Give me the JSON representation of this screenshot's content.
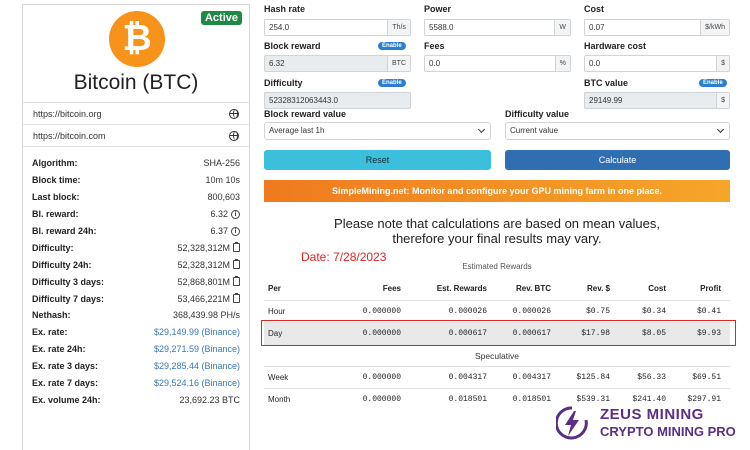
{
  "coin": {
    "name": "Bitcoin (BTC)",
    "symbol_glyph": "₿",
    "status": "Active",
    "links": [
      "https://bitcoin.org",
      "https://bitcoin.com"
    ]
  },
  "stats": [
    {
      "label": "Algorithm:",
      "value": "SHA-256",
      "icon": ""
    },
    {
      "label": "Block time:",
      "value": "10m 10s",
      "icon": ""
    },
    {
      "label": "Last block:",
      "value": "800,603",
      "icon": ""
    },
    {
      "label": "Bl. reward:",
      "value": "6.32",
      "icon": "info-icon"
    },
    {
      "label": "Bl. reward 24h:",
      "value": "6.37",
      "icon": "info-icon"
    },
    {
      "label": "Difficulty:",
      "value": "52,328,312M",
      "icon": "clipboard-icon"
    },
    {
      "label": "Difficulty 24h:",
      "value": "52,328,312M",
      "icon": "clipboard-icon"
    },
    {
      "label": "Difficulty 3 days:",
      "value": "52,868,801M",
      "icon": "clipboard-icon"
    },
    {
      "label": "Difficulty 7 days:",
      "value": "53,466,221M",
      "icon": "clipboard-icon"
    },
    {
      "label": "Nethash:",
      "value": "368,439.98 PH/s",
      "icon": ""
    },
    {
      "label": "Ex. rate:",
      "value": "$29,149.99 (Binance)",
      "icon": "link"
    },
    {
      "label": "Ex. rate 24h:",
      "value": "$29,271.59 (Binance)",
      "icon": "link"
    },
    {
      "label": "Ex. rate 3 days:",
      "value": "$29,285.44 (Binance)",
      "icon": "link"
    },
    {
      "label": "Ex. rate 7 days:",
      "value": "$29,524.16 (Binance)",
      "icon": "link"
    },
    {
      "label": "Ex. volume 24h:",
      "value": "23,692.23 BTC",
      "icon": ""
    }
  ],
  "form": {
    "hash_rate": {
      "label": "Hash rate",
      "value": "254.0",
      "unit": "Th/s"
    },
    "power": {
      "label": "Power",
      "value": "5588.0",
      "unit": "W"
    },
    "cost": {
      "label": "Cost",
      "value": "0.07",
      "unit": "$/kWh"
    },
    "block_reward": {
      "label": "Block reward",
      "value": "6.32",
      "unit": "BTC",
      "badge": "Enable"
    },
    "fees": {
      "label": "Fees",
      "value": "0.0",
      "unit": "%"
    },
    "hardware_cost": {
      "label": "Hardware cost",
      "value": "0.0",
      "unit": "$"
    },
    "difficulty": {
      "label": "Difficulty",
      "value": "52328312063443.0",
      "badge": "Enable"
    },
    "btc_value": {
      "label": "BTC value",
      "value": "29149.99",
      "unit": "$",
      "badge": "Enable"
    },
    "block_reward_value": {
      "label": "Block reward value",
      "selected": "Average last 1h"
    },
    "difficulty_value": {
      "label": "Difficulty value",
      "selected": "Current value"
    },
    "reset_label": "Reset",
    "calculate_label": "Calculate"
  },
  "promo": "SimpleMining.net: Monitor and configure your GPU mining farm in one place.",
  "note_line1": "Please note that calculations are based on mean values,",
  "note_line2": "therefore your final results may vary.",
  "date_label": "Date: 7/28/2023",
  "estimated_title": "Estimated Rewards",
  "speculative_title": "Speculative",
  "table": {
    "headers": [
      "Per",
      "Fees",
      "Est. Rewards",
      "Rev. BTC",
      "Rev. $",
      "Cost",
      "Profit"
    ],
    "estimated": [
      [
        "Hour",
        "0.000000",
        "0.000026",
        "0.000026",
        "$0.75",
        "$0.34",
        "$0.41"
      ],
      [
        "Day",
        "0.000000",
        "0.000617",
        "0.000617",
        "$17.98",
        "$8.05",
        "$9.93"
      ]
    ],
    "speculative": [
      [
        "Week",
        "0.000000",
        "0.004317",
        "0.004317",
        "$125.84",
        "$56.33",
        "$69.51"
      ],
      [
        "Month",
        "0.000000",
        "0.018501",
        "0.018501",
        "$539.31",
        "$241.40",
        "$297.91"
      ]
    ]
  },
  "watermark": {
    "line1": "ZEUS MINING",
    "line2": "CRYPTO MINING PRO"
  },
  "colors": {
    "accent": "#2f6fb1",
    "reset": "#3cbfdc",
    "active": "#1e8a45",
    "bitcoin": "#f7931a",
    "highlight": "#e02323",
    "brand": "#5a2f86"
  }
}
